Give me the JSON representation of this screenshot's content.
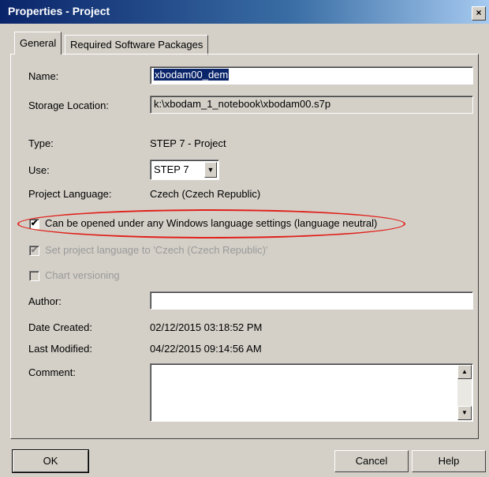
{
  "window": {
    "title": "Properties - Project",
    "close_glyph": "×"
  },
  "tabs": [
    {
      "label": "General",
      "active": true
    },
    {
      "label": "Required Software Packages",
      "active": false
    }
  ],
  "general": {
    "name_label": "Name:",
    "name_value": "xbodam00_dem",
    "storage_label": "Storage Location:",
    "storage_value": "k:\\xbodam_1_notebook\\xbodam00.s7p",
    "type_label": "Type:",
    "type_value": "STEP 7 - Project",
    "use_label": "Use:",
    "use_value": "STEP 7",
    "language_label": "Project Language:",
    "language_value": "Czech (Czech Republic)",
    "neutral_checkbox_label": "Can be opened under any Windows language settings (language neutral)",
    "neutral_checked": true,
    "set_language_label": "Set project language to 'Czech (Czech Republic)'",
    "set_language_checked": true,
    "chart_versioning_label": "Chart versioning",
    "chart_versioning_checked": false,
    "author_label": "Author:",
    "author_value": "",
    "date_created_label": "Date Created:",
    "date_created_value": "02/12/2015 03:18:52 PM",
    "last_modified_label": "Last Modified:",
    "last_modified_value": "04/22/2015 09:14:56 AM",
    "comment_label": "Comment:",
    "comment_value": ""
  },
  "buttons": {
    "ok": "OK",
    "cancel": "Cancel",
    "help": "Help"
  },
  "highlight_color": "#e0201a"
}
